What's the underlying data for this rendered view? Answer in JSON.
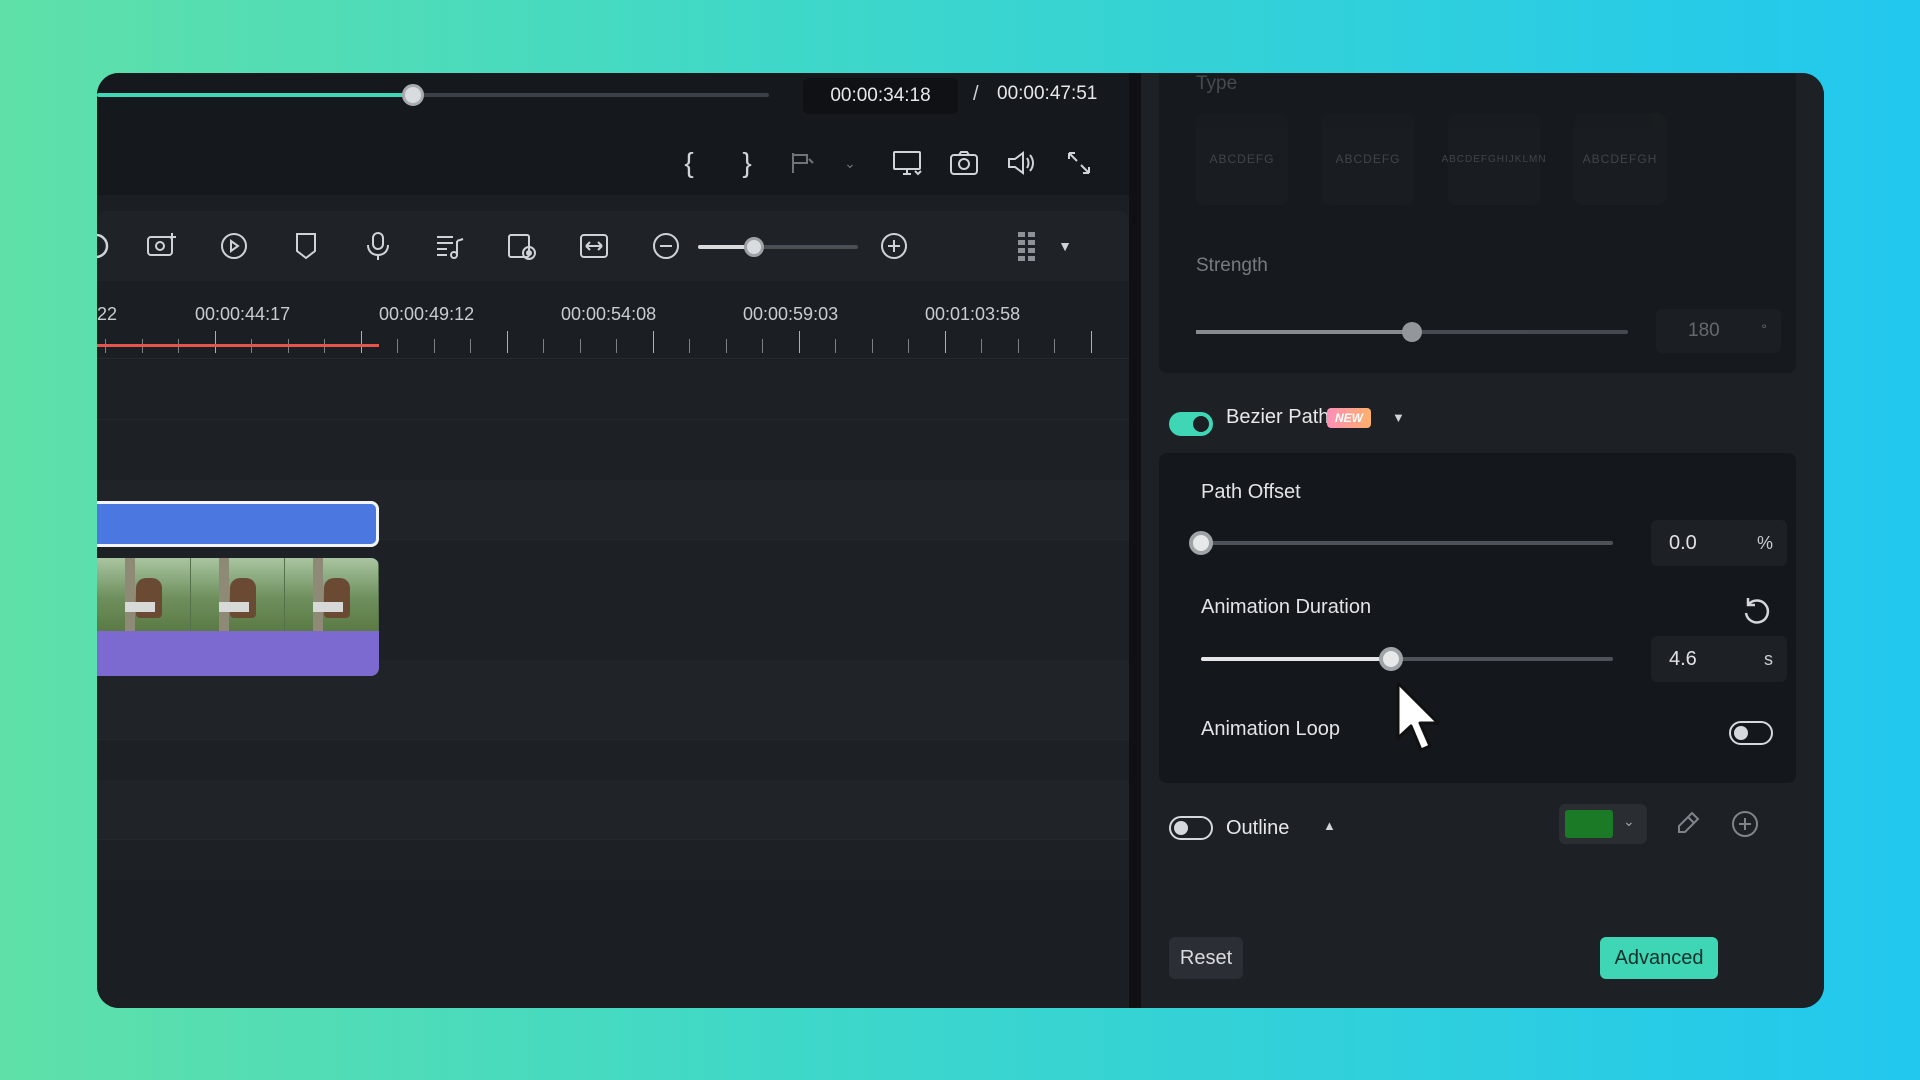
{
  "player": {
    "progress": 0.47,
    "current_time": "00:00:34:18",
    "separator": "/",
    "total_time": "00:00:47:51",
    "icons": [
      "mark-in-icon",
      "mark-out-icon",
      "split-icon",
      "display-icon",
      "snapshot-icon",
      "volume-icon",
      "fullscreen-icon"
    ]
  },
  "toolbar": {
    "icons": [
      "add-video-icon",
      "play-circle-icon",
      "marker-icon",
      "microphone-icon",
      "music-list-icon",
      "preview-icon",
      "fit-icon",
      "zoom-out-icon",
      "zoom-in-icon",
      "layout-grid-icon",
      "dropdown-caret-icon"
    ],
    "zoom_level": 0.35
  },
  "ruler": {
    "partial_label": "22",
    "labels": [
      "00:00:44:17",
      "00:00:49:12",
      "00:00:54:08",
      "00:00:59:03",
      "00:01:03:58"
    ]
  },
  "panel": {
    "type_label": "Type",
    "type_tiles": [
      "ABCDEFG",
      "ABCDEFG",
      "ABCDEFGHIJKLMN",
      "ABCDEFGH"
    ],
    "strength_label": "Strength",
    "strength_value": "180",
    "strength_unit": "°",
    "strength_level": 0.5,
    "bezier": {
      "enabled": true,
      "label": "Bezier Path",
      "badge": "NEW",
      "path_offset_label": "Path Offset",
      "path_offset_value": "0.0",
      "path_offset_unit": "%",
      "path_offset_level": 0.0,
      "duration_label": "Animation Duration",
      "duration_value": "4.6",
      "duration_unit": "s",
      "duration_level": 0.46,
      "loop_label": "Animation Loop",
      "loop_enabled": false
    },
    "outline": {
      "enabled": false,
      "label": "Outline",
      "color": "#1a7a26"
    },
    "reset_label": "Reset",
    "advanced_label": "Advanced"
  },
  "colors": {
    "accent": "#3fd6b6",
    "title_clip": "#4a78e0",
    "audio_clip": "#7d6ad0",
    "playhead_range": "#e7554a"
  }
}
